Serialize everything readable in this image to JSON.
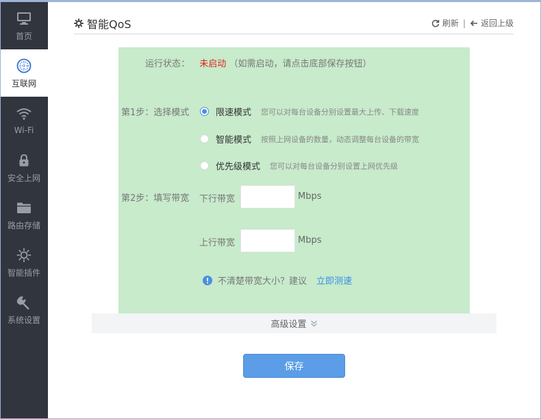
{
  "sidebar": {
    "items": [
      {
        "label": "首页",
        "icon": "monitor-icon"
      },
      {
        "label": "互联网",
        "icon": "globe-icon",
        "active": true
      },
      {
        "label": "Wi-Fi",
        "icon": "wifi-icon"
      },
      {
        "label": "安全上网",
        "icon": "lock-icon"
      },
      {
        "label": "路由存储",
        "icon": "folder-icon"
      },
      {
        "label": "智能插件",
        "icon": "sun-icon"
      },
      {
        "label": "系统设置",
        "icon": "wrench-icon"
      }
    ]
  },
  "header": {
    "title": "智能QoS",
    "refresh": "刷新",
    "separator": "|",
    "back": "返回上级"
  },
  "status": {
    "label": "运行状态：",
    "value": "未启动",
    "note": "（如需启动，请点击底部保存按钮）"
  },
  "step1": {
    "label": "第1步：选择模式",
    "modes": [
      {
        "name": "限速模式",
        "desc": "您可以对每台设备分别设置最大上传、下载速度",
        "selected": true
      },
      {
        "name": "智能模式",
        "desc": "按照上网设备的数量，动态调整每台设备的带宽",
        "selected": false
      },
      {
        "name": "优先级模式",
        "desc": "您可以对每台设备分别设置上网优先级",
        "selected": false
      }
    ]
  },
  "step2": {
    "label": "第2步：填写带宽",
    "download_label": "下行带宽",
    "download_value": "",
    "upload_label": "上行带宽",
    "upload_value": "",
    "unit": "Mbps"
  },
  "hint": {
    "text": "不清楚带宽大小？建议",
    "link": "立即测速"
  },
  "advanced": {
    "label": "高级设置"
  },
  "save": {
    "label": "保存"
  },
  "colors": {
    "sidebar_bg": "#31353d",
    "panel_bg": "#c7ebcb",
    "accent": "#4a8fe0",
    "status_red": "#e2231a",
    "save_bg": "#5b9de6"
  }
}
